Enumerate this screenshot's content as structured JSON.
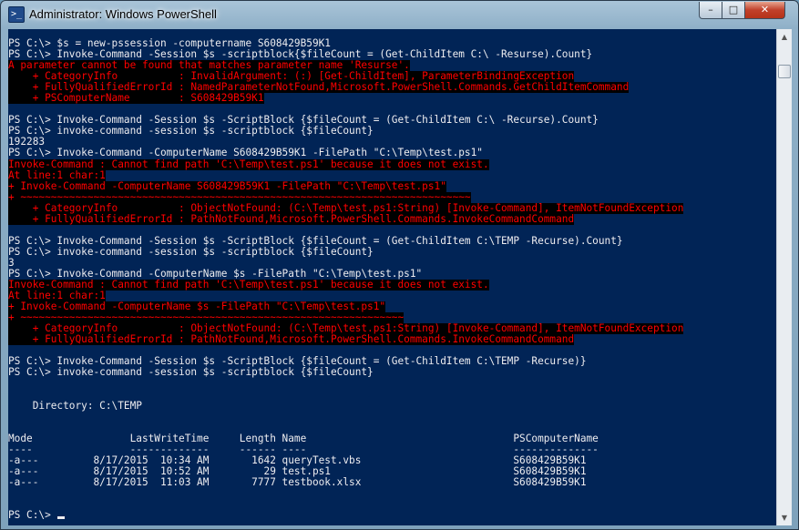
{
  "window": {
    "title": "Administrator: Windows PowerShell",
    "icon": "powershell-icon",
    "buttons": {
      "minimize": "–",
      "maximize": "□",
      "close": "✕"
    }
  },
  "colors": {
    "console_bg": "#012456",
    "text": "#eeedf0",
    "error_fg": "#ff0000",
    "error_bg": "#000000"
  },
  "console": {
    "lines": [
      {
        "text": "PS C:\\> $s = new-pssession -computername S608429B59K1",
        "type": "normal"
      },
      {
        "text": "PS C:\\> Invoke-Command -Session $s -scriptblock{$fileCount = (Get-ChildItem C:\\ -Resurse).Count}",
        "type": "normal"
      },
      {
        "text": "A parameter cannot be found that matches parameter name 'Resurse'.",
        "type": "error"
      },
      {
        "text": "    + CategoryInfo          : InvalidArgument: (:) [Get-ChildItem], ParameterBindingException",
        "type": "error"
      },
      {
        "text": "    + FullyQualifiedErrorId : NamedParameterNotFound,Microsoft.PowerShell.Commands.GetChildItemCommand",
        "type": "error"
      },
      {
        "text": "    + PSComputerName        : S608429B59K1",
        "type": "error"
      },
      {
        "text": "",
        "type": "normal"
      },
      {
        "text": "PS C:\\> Invoke-Command -Session $s -ScriptBlock {$fileCount = (Get-ChildItem C:\\ -Recurse).Count}",
        "type": "normal"
      },
      {
        "text": "PS C:\\> invoke-command -session $s -scriptblock {$fileCount}",
        "type": "normal"
      },
      {
        "text": "192283",
        "type": "normal"
      },
      {
        "text": "PS C:\\> Invoke-Command -ComputerName S608429B59K1 -FilePath \"C:\\Temp\\test.ps1\"",
        "type": "normal"
      },
      {
        "text": "Invoke-Command : Cannot find path 'C:\\Temp\\test.ps1' because it does not exist.",
        "type": "error"
      },
      {
        "text": "At line:1 char:1",
        "type": "error"
      },
      {
        "text": "+ Invoke-Command -ComputerName S608429B59K1 -FilePath \"C:\\Temp\\test.ps1\"",
        "type": "error"
      },
      {
        "text": "+ ~~~~~~~~~~~~~~~~~~~~~~~~~~~~~~~~~~~~~~~~~~~~~~~~~~~~~~~~~~~~~~~~~~~~~~~~~~",
        "type": "error"
      },
      {
        "text": "    + CategoryInfo          : ObjectNotFound: (C:\\Temp\\test.ps1:String) [Invoke-Command], ItemNotFoundException",
        "type": "error"
      },
      {
        "text": "    + FullyQualifiedErrorId : PathNotFound,Microsoft.PowerShell.Commands.InvokeCommandCommand",
        "type": "error"
      },
      {
        "text": "",
        "type": "normal"
      },
      {
        "text": "PS C:\\> Invoke-Command -Session $s -ScriptBlock {$fileCount = (Get-ChildItem C:\\TEMP -Recurse).Count}",
        "type": "normal"
      },
      {
        "text": "PS C:\\> invoke-command -session $s -scriptblock {$fileCount}",
        "type": "normal"
      },
      {
        "text": "3",
        "type": "normal"
      },
      {
        "text": "PS C:\\> Invoke-Command -ComputerName $s -FilePath \"C:\\Temp\\test.ps1\"",
        "type": "normal"
      },
      {
        "text": "Invoke-Command : Cannot find path 'C:\\Temp\\test.ps1' because it does not exist.",
        "type": "error"
      },
      {
        "text": "At line:1 char:1",
        "type": "error"
      },
      {
        "text": "+ Invoke-Command -ComputerName $s -FilePath \"C:\\Temp\\test.ps1\"",
        "type": "error"
      },
      {
        "text": "+ ~~~~~~~~~~~~~~~~~~~~~~~~~~~~~~~~~~~~~~~~~~~~~~~~~~~~~~~~~~~~~~~",
        "type": "error"
      },
      {
        "text": "    + CategoryInfo          : ObjectNotFound: (C:\\Temp\\test.ps1:String) [Invoke-Command], ItemNotFoundException",
        "type": "error"
      },
      {
        "text": "    + FullyQualifiedErrorId : PathNotFound,Microsoft.PowerShell.Commands.InvokeCommandCommand",
        "type": "error"
      },
      {
        "text": "",
        "type": "normal"
      },
      {
        "text": "PS C:\\> Invoke-Command -Session $s -ScriptBlock {$fileCount = (Get-ChildItem C:\\TEMP -Recurse)}",
        "type": "normal"
      },
      {
        "text": "PS C:\\> invoke-command -session $s -scriptblock {$fileCount}",
        "type": "normal"
      },
      {
        "text": "",
        "type": "normal"
      },
      {
        "text": "",
        "type": "normal"
      },
      {
        "text": "    Directory: C:\\TEMP",
        "type": "normal"
      },
      {
        "text": "",
        "type": "normal"
      },
      {
        "text": "",
        "type": "normal"
      },
      {
        "text": "Mode                LastWriteTime     Length Name                                  PSComputerName",
        "type": "normal"
      },
      {
        "text": "----                -------------     ------ ----                                  --------------",
        "type": "normal"
      },
      {
        "text": "-a---         8/17/2015  10:34 AM       1642 queryTest.vbs                         S608429B59K1",
        "type": "normal"
      },
      {
        "text": "-a---         8/17/2015  10:52 AM         29 test.ps1                              S608429B59K1",
        "type": "normal"
      },
      {
        "text": "-a---         8/17/2015  11:03 AM       7777 testbook.xlsx                         S608429B59K1",
        "type": "normal"
      },
      {
        "text": "",
        "type": "normal"
      },
      {
        "text": "",
        "type": "normal"
      },
      {
        "text": "PS C:\\> ",
        "type": "prompt"
      }
    ]
  },
  "scrollbar": {
    "up_arrow": "▲",
    "down_arrow": "▼"
  }
}
